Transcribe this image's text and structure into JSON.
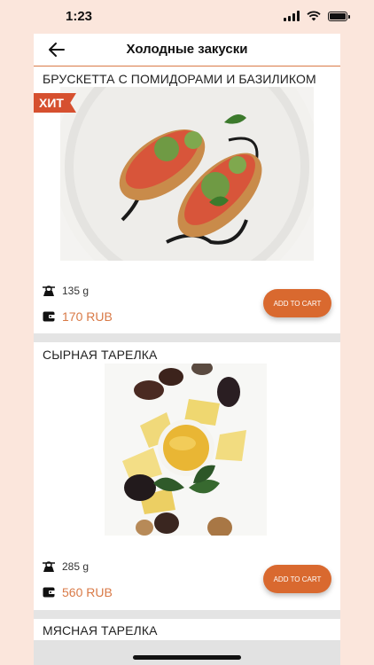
{
  "status": {
    "time": "1:23"
  },
  "header": {
    "title": "Холодные закуски"
  },
  "products": [
    {
      "name": "БРУСКЕТТА С ПОМИДОРАМИ И БАЗИЛИКОМ",
      "badge": "ХИТ",
      "weight": "135 g",
      "price": "170 RUB",
      "button": "ADD TO CART"
    },
    {
      "name": "СЫРНАЯ ТАРЕЛКА",
      "weight": "285 g",
      "price": "560 RUB",
      "button": "ADD TO CART"
    },
    {
      "name": "МЯСНАЯ ТАРЕЛКА"
    }
  ],
  "colors": {
    "accent": "#d9692f",
    "price": "#d97a47",
    "badge": "#d6502f",
    "background": "#fbe6dc"
  }
}
